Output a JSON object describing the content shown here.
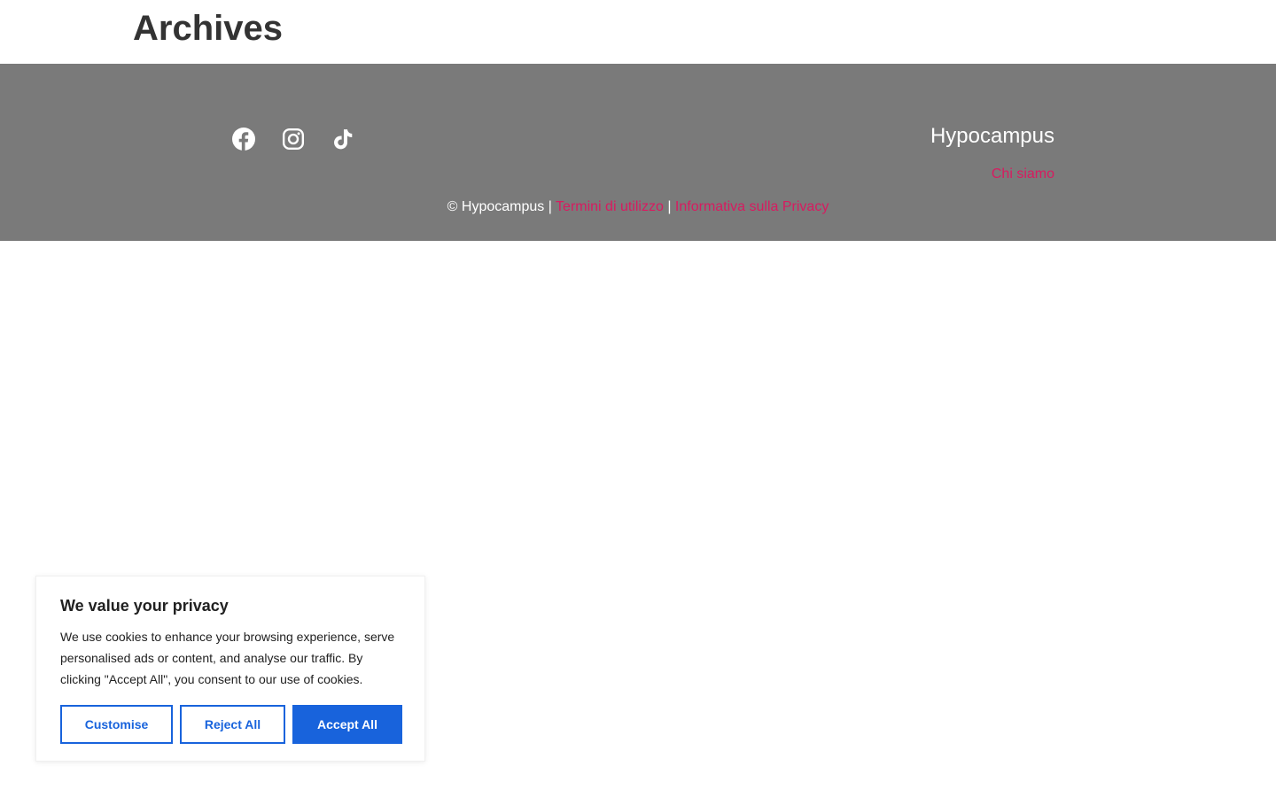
{
  "header": {
    "title": "Archives"
  },
  "footer": {
    "social": [
      {
        "name": "facebook-icon"
      },
      {
        "name": "instagram-icon"
      },
      {
        "name": "tiktok-icon"
      }
    ],
    "brand": "Hypocampus",
    "about_link": "Chi siamo",
    "copyright_prefix": "© Hypocampus |",
    "terms_link": "Termini di utilizzo",
    "separator": "|",
    "privacy_link": "Informativa sulla Privacy"
  },
  "cookie_banner": {
    "title": "We value your privacy",
    "text": "We use cookies to enhance your browsing experience, serve personalised ads or content, and analyse our traffic. By clicking \"Accept All\", you consent to our use of cookies.",
    "customise_label": "Customise",
    "reject_label": "Reject All",
    "accept_label": "Accept All"
  },
  "colors": {
    "footer_bg": "#7a7a7a",
    "link_accent": "#d81b60",
    "button_blue": "#1863dc"
  }
}
